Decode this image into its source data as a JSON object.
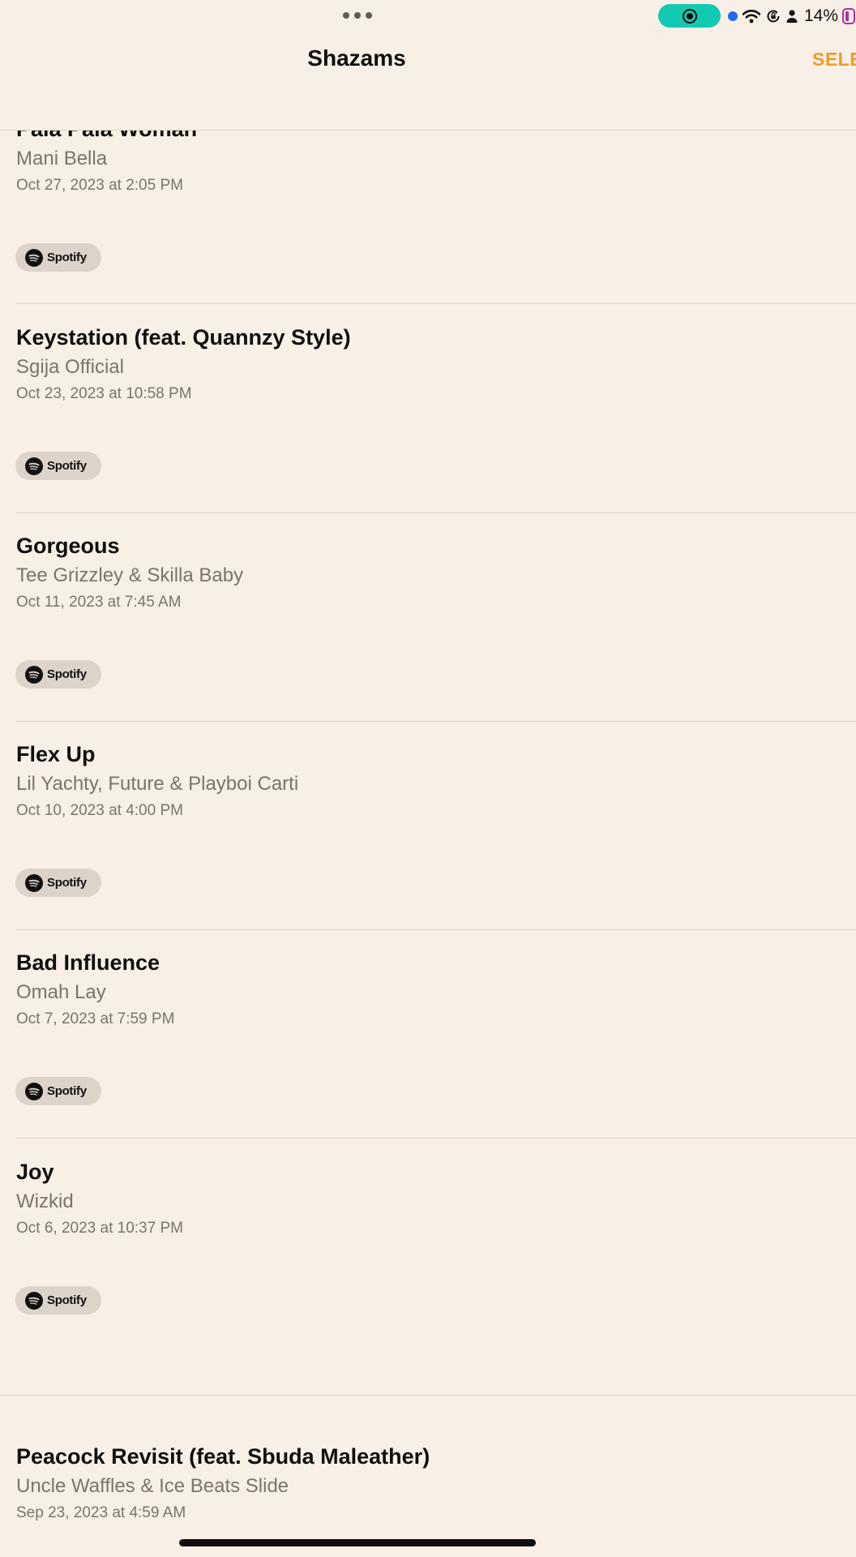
{
  "status_bar": {
    "battery_percent": "14%",
    "icons": [
      "multitask-dots-icon",
      "screen-record-icon",
      "location-dot-icon",
      "wifi-icon",
      "orientation-lock-icon",
      "person-icon",
      "battery-icon"
    ]
  },
  "nav": {
    "title": "Shazams",
    "select_label": "SELE"
  },
  "songs": [
    {
      "title": "Pala Pala Woman",
      "artist": "Mani Bella",
      "date": "Oct 27, 2023 at 2:05 PM",
      "service": "Spotify"
    },
    {
      "title": "Keystation (feat. Quannzy Style)",
      "artist": "Sgija Official",
      "date": "Oct 23, 2023 at 10:58 PM",
      "service": "Spotify"
    },
    {
      "title": "Gorgeous",
      "artist": "Tee Grizzley & Skilla Baby",
      "date": "Oct 11, 2023 at 7:45 AM",
      "service": "Spotify"
    },
    {
      "title": "Flex Up",
      "artist": "Lil Yachty, Future & Playboi Carti",
      "date": "Oct 10, 2023 at 4:00 PM",
      "service": "Spotify"
    },
    {
      "title": "Bad Influence",
      "artist": "Omah Lay",
      "date": "Oct 7, 2023 at 7:59 PM",
      "service": "Spotify"
    },
    {
      "title": "Joy",
      "artist": "Wizkid",
      "date": "Oct 6, 2023 at 10:37 PM",
      "service": "Spotify"
    },
    {
      "title": "Peacock Revisit (feat. Sbuda Maleather)",
      "artist": "Uncle Waffles & Ice Beats Slide",
      "date": "Sep 23, 2023 at 4:59 AM"
    }
  ],
  "colors": {
    "background": "#f8efe6",
    "accent": "#f19a2a",
    "record_pill": "#12c9b2",
    "secondary_text": "#7b746d",
    "chip_background": "#dcd3cb"
  }
}
